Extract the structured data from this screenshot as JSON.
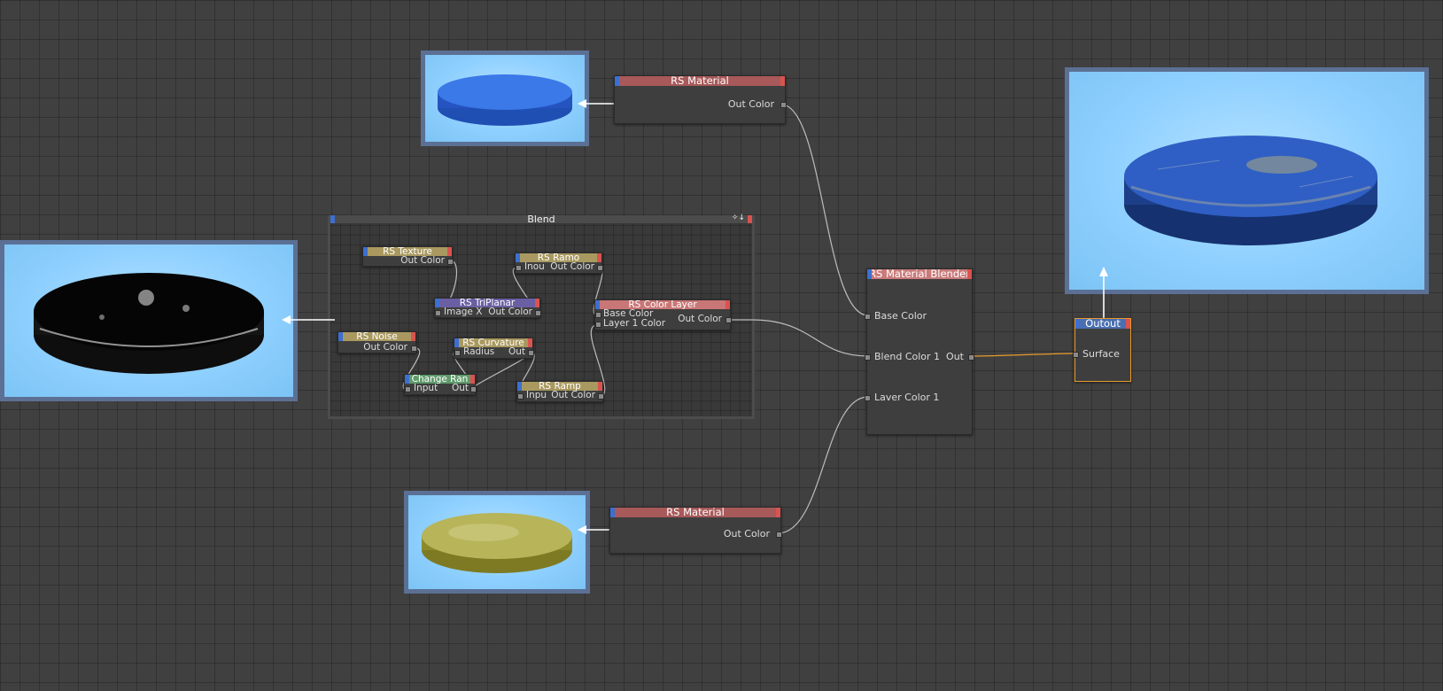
{
  "wire_color": "#bdbdbd",
  "active_wire_color": "#e89a2c",
  "nodes": {
    "rs_material_top": {
      "title": "RS Material",
      "out": "Out Color",
      "title_color": "#a8595a"
    },
    "rs_material_bottom": {
      "title": "RS Material",
      "out": "Out Color",
      "title_color": "#a8595a"
    },
    "blender": {
      "title": "RS Material Blender",
      "in1": "Base Color",
      "in2": "Blend Color 1",
      "in3": "Laver Color 1",
      "out": "Out",
      "title_color": "#c97a7a"
    },
    "output": {
      "title": "Outout",
      "in": "Surface",
      "title_color": "#4a6fb0"
    }
  },
  "group": {
    "title": "Blend",
    "controls": "✧↓",
    "nodes": {
      "texture": {
        "title": "RS Texture",
        "out": "Out Color",
        "title_color": "#a99960"
      },
      "ramp1": {
        "title": "RS Ramo",
        "in": "Inou",
        "out": "Out Color",
        "title_color": "#a99960"
      },
      "triplanar": {
        "title": "RS TriPlanar",
        "in": "Image X",
        "out": "Out Color",
        "title_color": "#6b5fa3"
      },
      "color_layer": {
        "title": "RS Color Layer",
        "in1": "Base Color",
        "in2": "Layer 1 Color",
        "out": "Out Color",
        "title_color": "#c97676"
      },
      "noise": {
        "title": "RS Noise",
        "out": "Out Color",
        "title_color": "#a99960"
      },
      "curvature": {
        "title": "RS Curvature",
        "in": "Radius",
        "out": "Out",
        "title_color": "#a99960"
      },
      "change_range": {
        "title": "Change Ran",
        "in": "Input",
        "out": "Out",
        "title_color": "#5f9a6b"
      },
      "ramp2": {
        "title": "RS Ramp",
        "in": "Inpu",
        "out": "Out Color",
        "title_color": "#a99960"
      }
    }
  }
}
